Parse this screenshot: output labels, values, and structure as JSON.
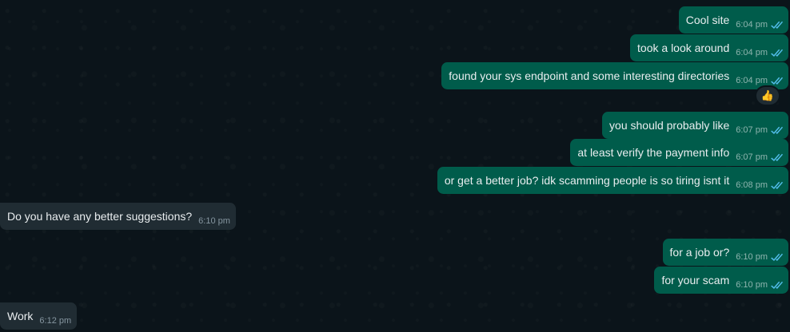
{
  "chat": {
    "messages": [
      {
        "id": 1,
        "direction": "out",
        "text": "Cool site",
        "time": "6:04 pm",
        "status": "read"
      },
      {
        "id": 2,
        "direction": "out",
        "text": "took a look around",
        "time": "6:04 pm",
        "status": "read"
      },
      {
        "id": 3,
        "direction": "out",
        "text": "found your sys endpoint and some interesting directories",
        "time": "6:04 pm",
        "status": "read",
        "reaction": "👍"
      },
      {
        "id": 4,
        "direction": "out",
        "text": "you should probably like",
        "time": "6:07 pm",
        "status": "read"
      },
      {
        "id": 5,
        "direction": "out",
        "text": "at least verify the payment info",
        "time": "6:07 pm",
        "status": "read"
      },
      {
        "id": 6,
        "direction": "out",
        "text": "or get a better job? idk scamming people is so tiring isnt it",
        "time": "6:08 pm",
        "status": "read"
      },
      {
        "id": 7,
        "direction": "in",
        "text": "Do you have any better suggestions?",
        "time": "6:10 pm"
      },
      {
        "id": 8,
        "direction": "out",
        "text": "for a job or?",
        "time": "6:10 pm",
        "status": "read"
      },
      {
        "id": 9,
        "direction": "out",
        "text": "for your scam",
        "time": "6:10 pm",
        "status": "read"
      },
      {
        "id": 10,
        "direction": "in",
        "text": "Work",
        "time": "6:12 pm"
      }
    ]
  },
  "colors": {
    "background": "#0b141a",
    "outgoing_bubble": "#005c4b",
    "incoming_bubble": "#202c33",
    "read_ticks": "#53bdeb",
    "text": "#e9edef"
  },
  "icons": {
    "read_receipt": "double-check-icon",
    "reaction": "thumbs-up-emoji"
  }
}
